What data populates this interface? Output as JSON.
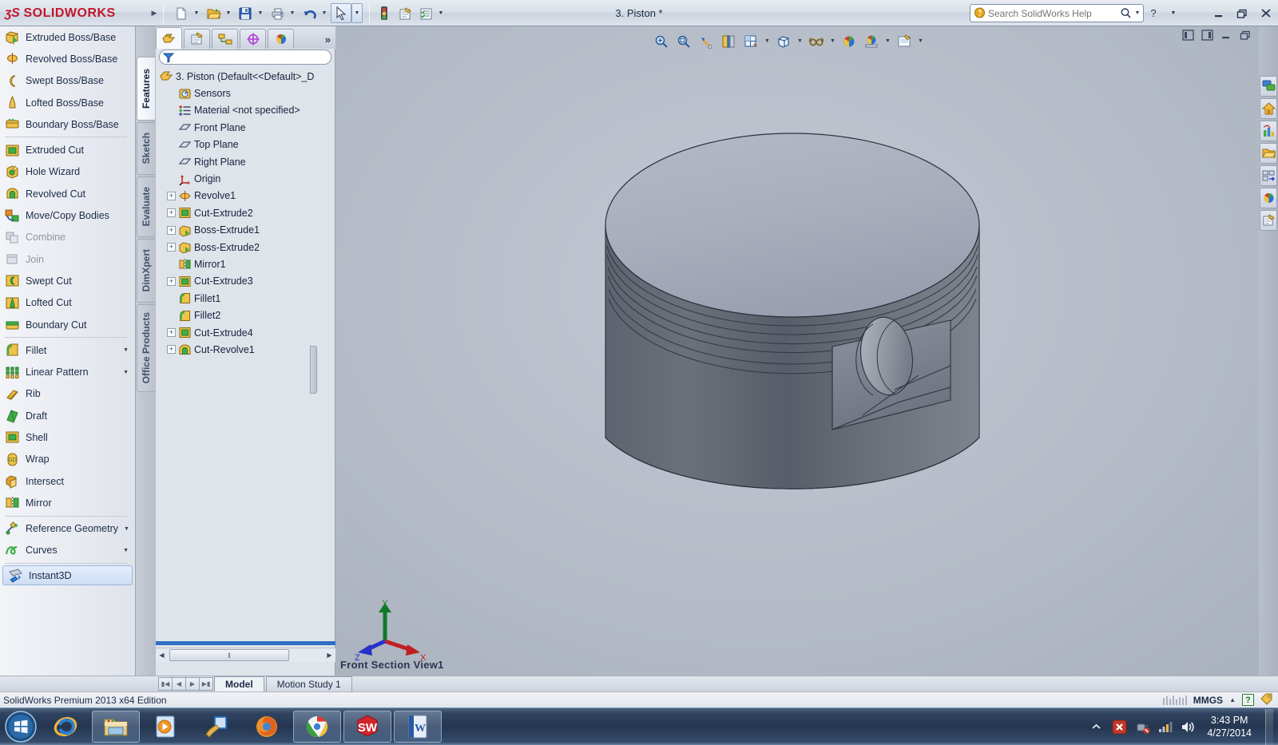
{
  "titlebar": {
    "logo_ds": "ʒS",
    "logo_text": "SOLIDWORKS",
    "document_title": "3. Piston *",
    "search_placeholder": "Search SolidWorks Help",
    "search_value": "",
    "buttons": [
      {
        "name": "new-document",
        "label": "New"
      },
      {
        "name": "open-document",
        "label": "Open"
      },
      {
        "name": "save-document",
        "label": "Save"
      },
      {
        "name": "print-document",
        "label": "Print"
      },
      {
        "name": "undo",
        "label": "Undo"
      },
      {
        "name": "select",
        "label": "Select"
      },
      {
        "name": "rebuild",
        "label": "Rebuild"
      },
      {
        "name": "file-properties",
        "label": "File Properties"
      },
      {
        "name": "options",
        "label": "Options"
      }
    ],
    "window_controls": [
      "minimize",
      "restore",
      "close"
    ]
  },
  "command_manager": {
    "groups": [
      {
        "items": [
          {
            "label": "Extruded Boss/Base",
            "icon": "extruded-boss-icon",
            "dim": false,
            "dropdown": false
          },
          {
            "label": "Revolved Boss/Base",
            "icon": "revolved-boss-icon",
            "dim": false,
            "dropdown": false
          },
          {
            "label": "Swept Boss/Base",
            "icon": "swept-boss-icon",
            "dim": false,
            "dropdown": false
          },
          {
            "label": "Lofted Boss/Base",
            "icon": "lofted-boss-icon",
            "dim": false,
            "dropdown": false
          },
          {
            "label": "Boundary Boss/Base",
            "icon": "boundary-boss-icon",
            "dim": false,
            "dropdown": false
          }
        ]
      },
      {
        "items": [
          {
            "label": "Extruded Cut",
            "icon": "extruded-cut-icon",
            "dim": false,
            "dropdown": false
          },
          {
            "label": "Hole Wizard",
            "icon": "hole-wizard-icon",
            "dim": false,
            "dropdown": false
          },
          {
            "label": "Revolved Cut",
            "icon": "revolved-cut-icon",
            "dim": false,
            "dropdown": false
          },
          {
            "label": "Move/Copy Bodies",
            "icon": "move-copy-bodies-icon",
            "dim": false,
            "dropdown": false
          },
          {
            "label": "Combine",
            "icon": "combine-icon",
            "dim": true,
            "dropdown": false
          },
          {
            "label": "Join",
            "icon": "join-icon",
            "dim": true,
            "dropdown": false
          },
          {
            "label": "Swept Cut",
            "icon": "swept-cut-icon",
            "dim": false,
            "dropdown": false
          },
          {
            "label": "Lofted Cut",
            "icon": "lofted-cut-icon",
            "dim": false,
            "dropdown": false
          },
          {
            "label": "Boundary Cut",
            "icon": "boundary-cut-icon",
            "dim": false,
            "dropdown": false
          }
        ]
      },
      {
        "items": [
          {
            "label": "Fillet",
            "icon": "fillet-icon",
            "dim": false,
            "dropdown": true
          },
          {
            "label": "Linear Pattern",
            "icon": "linear-pattern-icon",
            "dim": false,
            "dropdown": true
          },
          {
            "label": "Rib",
            "icon": "rib-icon",
            "dim": false,
            "dropdown": false
          },
          {
            "label": "Draft",
            "icon": "draft-icon",
            "dim": false,
            "dropdown": false
          },
          {
            "label": "Shell",
            "icon": "shell-icon",
            "dim": false,
            "dropdown": false
          },
          {
            "label": "Wrap",
            "icon": "wrap-icon",
            "dim": false,
            "dropdown": false
          },
          {
            "label": "Intersect",
            "icon": "intersect-icon",
            "dim": false,
            "dropdown": false
          },
          {
            "label": "Mirror",
            "icon": "mirror-icon",
            "dim": false,
            "dropdown": false
          }
        ]
      },
      {
        "items": [
          {
            "label": "Reference Geometry",
            "icon": "reference-geometry-icon",
            "dim": false,
            "dropdown": true
          },
          {
            "label": "Curves",
            "icon": "curves-icon",
            "dim": false,
            "dropdown": true
          }
        ]
      },
      {
        "items": [
          {
            "label": "Instant3D",
            "icon": "instant3d-icon",
            "dim": false,
            "dropdown": false,
            "selected": true
          }
        ]
      }
    ]
  },
  "side_tabs": [
    {
      "label": "Features",
      "active": true
    },
    {
      "label": "Sketch",
      "active": false
    },
    {
      "label": "Evaluate",
      "active": false
    },
    {
      "label": "DimXpert",
      "active": false
    },
    {
      "label": "Office Products",
      "active": false
    }
  ],
  "tree_panel": {
    "tabs": [
      {
        "name": "feature-manager-tab",
        "icon": "feature-tree-icon",
        "active": true
      },
      {
        "name": "property-manager-tab",
        "icon": "property-manager-icon",
        "active": false
      },
      {
        "name": "configuration-manager-tab",
        "icon": "configuration-manager-icon",
        "active": false
      },
      {
        "name": "dimxpert-manager-tab",
        "icon": "dimxpert-target-icon",
        "active": false
      },
      {
        "name": "display-manager-tab",
        "icon": "display-manager-sphere-icon",
        "active": false
      }
    ],
    "more_tabs_label": "»",
    "filter_placeholder": "",
    "filter_value": "",
    "items": [
      {
        "label": "3. Piston  (Default<<Default>_D",
        "icon": "part-icon",
        "indent": 0,
        "expandable": false,
        "root": true
      },
      {
        "label": "Sensors",
        "icon": "sensors-icon",
        "indent": 1,
        "expandable": false
      },
      {
        "label": "Material <not specified>",
        "icon": "material-icon",
        "indent": 1,
        "expandable": false
      },
      {
        "label": "Front Plane",
        "icon": "plane-icon",
        "indent": 1,
        "expandable": false
      },
      {
        "label": "Top Plane",
        "icon": "plane-icon",
        "indent": 1,
        "expandable": false
      },
      {
        "label": "Right Plane",
        "icon": "plane-icon",
        "indent": 1,
        "expandable": false
      },
      {
        "label": "Origin",
        "icon": "origin-icon",
        "indent": 1,
        "expandable": false
      },
      {
        "label": "Revolve1",
        "icon": "revolve-icon",
        "indent": 1,
        "expandable": true
      },
      {
        "label": "Cut-Extrude2",
        "icon": "cut-extrude-icon",
        "indent": 1,
        "expandable": true
      },
      {
        "label": "Boss-Extrude1",
        "icon": "boss-extrude-icon",
        "indent": 1,
        "expandable": true
      },
      {
        "label": "Boss-Extrude2",
        "icon": "boss-extrude-icon",
        "indent": 1,
        "expandable": true
      },
      {
        "label": "Mirror1",
        "icon": "mirror-feature-icon",
        "indent": 1,
        "expandable": false
      },
      {
        "label": "Cut-Extrude3",
        "icon": "cut-extrude-icon",
        "indent": 1,
        "expandable": true
      },
      {
        "label": "Fillet1",
        "icon": "fillet-feature-icon",
        "indent": 1,
        "expandable": false
      },
      {
        "label": "Fillet2",
        "icon": "fillet-feature-icon",
        "indent": 1,
        "expandable": false
      },
      {
        "label": "Cut-Extrude4",
        "icon": "cut-extrude-icon",
        "indent": 1,
        "expandable": true
      },
      {
        "label": "Cut-Revolve1",
        "icon": "cut-revolve-icon",
        "indent": 1,
        "expandable": true
      }
    ],
    "scroll_grip": "‖"
  },
  "view_toolbar": {
    "buttons": [
      {
        "name": "zoom-to-fit-button",
        "icon": "zoom-fit-icon",
        "caret": false
      },
      {
        "name": "zoom-to-area-button",
        "icon": "zoom-area-icon",
        "caret": false
      },
      {
        "name": "previous-view-button",
        "icon": "previous-view-icon",
        "caret": false
      },
      {
        "name": "section-view-button",
        "icon": "section-view-icon",
        "caret": false
      },
      {
        "name": "view-orientation-button",
        "icon": "view-orientation-icon",
        "caret": true
      },
      {
        "name": "display-style-button",
        "icon": "display-style-icon",
        "caret": true
      },
      {
        "name": "hide-show-items-button",
        "icon": "hide-show-glasses-icon",
        "caret": true
      },
      {
        "name": "edit-appearance-button",
        "icon": "appearance-sphere-icon",
        "caret": false
      },
      {
        "name": "apply-scene-button",
        "icon": "apply-scene-icon",
        "caret": true
      },
      {
        "name": "view-settings-button",
        "icon": "view-settings-icon",
        "caret": true
      }
    ],
    "window_controls": [
      "restore-left",
      "restore-right",
      "minimize",
      "restore",
      "close"
    ]
  },
  "task_pane": {
    "buttons": [
      {
        "name": "solidworks-resources-button",
        "icon": "resources-chat-icon"
      },
      {
        "name": "design-library-button",
        "icon": "home-icon"
      },
      {
        "name": "file-explorer-button",
        "icon": "chart-icon"
      },
      {
        "name": "search-folder-button",
        "icon": "folder-icon"
      },
      {
        "name": "view-palette-button",
        "icon": "view-palette-icon"
      },
      {
        "name": "appearances-scenes-button",
        "icon": "appearance-sphere-icon"
      },
      {
        "name": "custom-properties-button",
        "icon": "custom-properties-icon"
      }
    ]
  },
  "graphics": {
    "view_label": "Front Section View1",
    "triad_axes": [
      {
        "label": "Y",
        "color": "#107c2b"
      },
      {
        "label": "X",
        "color": "#c41f22"
      },
      {
        "label": "Z",
        "color": "#2433c8"
      }
    ]
  },
  "bottom_tabs": {
    "nav_buttons": [
      "first",
      "previous",
      "next",
      "last"
    ],
    "tabs": [
      {
        "label": "Model",
        "active": true
      },
      {
        "label": "Motion Study 1",
        "active": false
      }
    ]
  },
  "status_bar": {
    "text": "SolidWorks Premium 2013 x64 Edition",
    "units": "MMGS",
    "units_caret": "▲",
    "help_badge": "?"
  },
  "taskbar": {
    "start_label": "Start",
    "items": [
      {
        "name": "internet-explorer-taskbar-icon",
        "boxed": false
      },
      {
        "name": "file-explorer-taskbar-icon",
        "boxed": true
      },
      {
        "name": "windows-media-player-taskbar-icon",
        "boxed": false
      },
      {
        "name": "paint-taskbar-icon",
        "boxed": false
      },
      {
        "name": "firefox-taskbar-icon",
        "boxed": false
      },
      {
        "name": "chrome-taskbar-icon",
        "boxed": true
      },
      {
        "name": "solidworks-taskbar-icon",
        "boxed": true
      },
      {
        "name": "word-taskbar-icon",
        "boxed": true
      }
    ],
    "tray_icons": [
      "show-hidden-icons",
      "antivirus-alert-icon",
      "network-unplugged-icon",
      "network-signal-icon",
      "volume-icon"
    ],
    "clock_time": "3:43 PM",
    "clock_date": "4/27/2014"
  },
  "colors": {
    "brand_red": "#c0172b",
    "accent_blue": "#2f6fc4",
    "graphics_bg": "#b5bcc7",
    "model_light": "#a8adbb",
    "model_dark": "#595e6b"
  }
}
